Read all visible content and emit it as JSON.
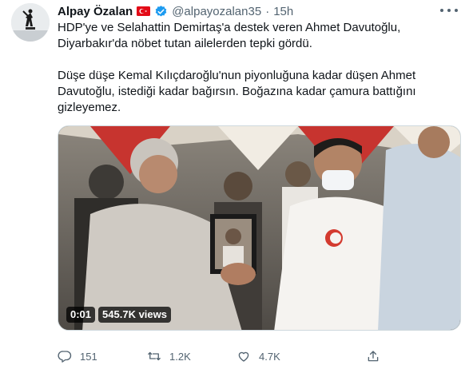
{
  "tweet": {
    "author": {
      "display_name": "Alpay Özalan",
      "handle": "@alpayozalan35",
      "separator": "·",
      "time": "15h",
      "flag_icon": "turkey-flag-icon",
      "verified_icon": "verified-badge-icon"
    },
    "text": {
      "line1": "HDP'ye ve Selahattin Demirtaş'a destek veren Ahmet Davutoğlu,",
      "line2": "Diyarbakır'da nöbet tutan ailelerden tepki gördü.",
      "line3": "Düşe düşe Kemal Kılıçdaroğlu'nun piyonluğuna kadar düşen Ahmet",
      "line4": "Davutoğlu, istediği kadar bağırsın. Boğazına kadar çamura battığını",
      "line5": "gizleyemez."
    },
    "media": {
      "type": "video",
      "time_label": "0:01",
      "views_label": "545.7K views"
    },
    "actions": {
      "reply_count": "151",
      "retweet_count": "1.2K",
      "like_count": "4.7K"
    }
  },
  "colors": {
    "text": "#0f1419",
    "secondary": "#536471",
    "verified": "#1d9bf0",
    "flag": "#e30a17"
  }
}
